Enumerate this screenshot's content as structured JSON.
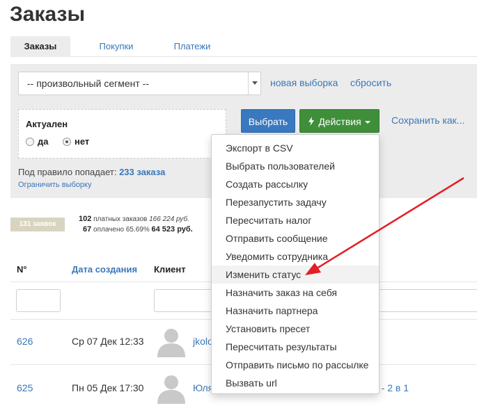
{
  "page": {
    "title": "Заказы"
  },
  "tabs": [
    {
      "label": "Заказы",
      "active": true
    },
    {
      "label": "Покупки",
      "active": false
    },
    {
      "label": "Платежи",
      "active": false
    }
  ],
  "filter": {
    "segment_value": "-- произвольный сегмент --",
    "new_selection": "новая выборка",
    "reset": "сбросить",
    "condition_label": "Актуален",
    "options": [
      {
        "label": "да",
        "checked": false
      },
      {
        "label": "нет",
        "checked": true
      }
    ],
    "select_button": "Выбрать",
    "actions_button": "Действия",
    "save_link": "Сохранить как..."
  },
  "rule": {
    "prefix": "Под правило попадает:",
    "count": "233 заказа",
    "limit_link": "Ограничить выборку"
  },
  "stats": {
    "badge": "131 заявок",
    "paid_count": "102",
    "paid_label": "платных заказов",
    "paid_sum": "166 224 руб.",
    "paid_pct_count": "67",
    "paid_pct_label": "оплачено 65.69%",
    "paid_pct_sum": "64 523 руб."
  },
  "table": {
    "columns": [
      "N°",
      "Дата создания",
      "Клиент"
    ],
    "rows": [
      {
        "number": "626",
        "date": "Ср 07 Дек 12:33",
        "client": "jkolo",
        "extra": ""
      },
      {
        "number": "625",
        "date": "Пн 05 Дек 17:30",
        "client": "Юля",
        "extra": "е - 2 в 1"
      }
    ]
  },
  "actions_menu": {
    "items": [
      "Экспорт в CSV",
      "Выбрать пользователей",
      "Создать рассылку",
      "Перезапустить задачу",
      "Пересчитать налог",
      "Отправить сообщение",
      "Уведомить сотрудника",
      "Изменить статус",
      "Назначить заказ на себя",
      "Назначить партнера",
      "Установить пресет",
      "Пересчитать результаты",
      "Отправить письмо по рассылке",
      "Вызвать url"
    ],
    "highlighted": "Изменить статус"
  },
  "colors": {
    "link": "#3a77b8",
    "primary_button": "#3a78c0",
    "success_button": "#3f8f3a",
    "annotation_arrow": "#e41e26"
  },
  "icons": [
    "chevron-down-icon",
    "bolt-icon",
    "caret-down-icon",
    "user-avatar-icon",
    "annotation-arrow-icon"
  ]
}
